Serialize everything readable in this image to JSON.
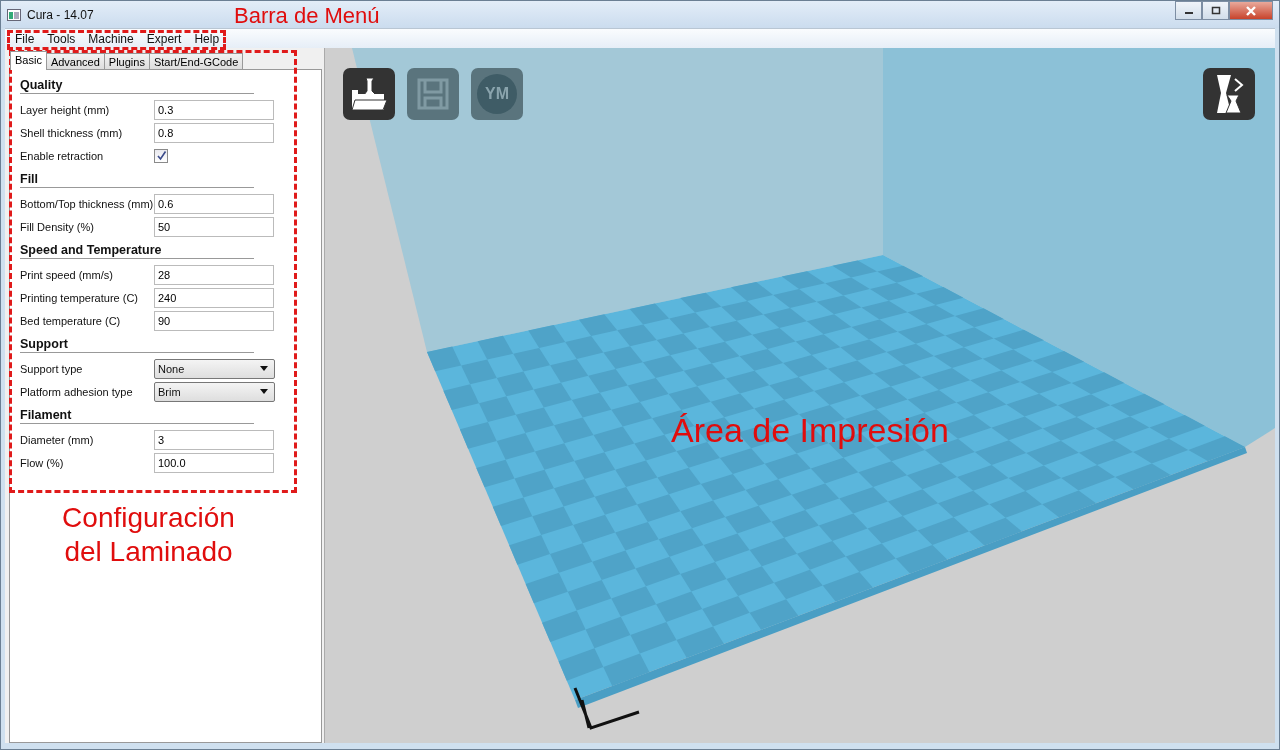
{
  "window": {
    "title": "Cura - 14.07"
  },
  "menu": [
    "File",
    "Tools",
    "Machine",
    "Expert",
    "Help"
  ],
  "tabs": [
    {
      "label": "Basic",
      "selected": true
    },
    {
      "label": "Advanced",
      "selected": false
    },
    {
      "label": "Plugins",
      "selected": false
    },
    {
      "label": "Start/End-GCode",
      "selected": false
    }
  ],
  "sections": [
    {
      "title": "Quality",
      "fields": [
        {
          "kind": "text",
          "label": "Layer height (mm)",
          "value": "0.3"
        },
        {
          "kind": "text",
          "label": "Shell thickness (mm)",
          "value": "0.8"
        },
        {
          "kind": "checkbox",
          "label": "Enable retraction",
          "checked": true
        }
      ]
    },
    {
      "title": "Fill",
      "fields": [
        {
          "kind": "text",
          "label": "Bottom/Top thickness (mm)",
          "value": "0.6"
        },
        {
          "kind": "text",
          "label": "Fill Density (%)",
          "value": "50"
        }
      ]
    },
    {
      "title": "Speed and Temperature",
      "fields": [
        {
          "kind": "text",
          "label": "Print speed (mm/s)",
          "value": "28"
        },
        {
          "kind": "text",
          "label": "Printing temperature (C)",
          "value": "240"
        },
        {
          "kind": "text",
          "label": "Bed temperature (C)",
          "value": "90"
        }
      ]
    },
    {
      "title": "Support",
      "fields": [
        {
          "kind": "select",
          "label": "Support type",
          "value": "None"
        },
        {
          "kind": "select",
          "label": "Platform adhesion type",
          "value": "Brim"
        }
      ]
    },
    {
      "title": "Filament",
      "fields": [
        {
          "kind": "text",
          "label": "Diameter (mm)",
          "value": "3"
        },
        {
          "kind": "text",
          "label": "Flow (%)",
          "value": "100.0"
        }
      ]
    }
  ],
  "toolbar": [
    {
      "kind": "load",
      "disabled": false
    },
    {
      "kind": "save",
      "disabled": true
    },
    {
      "kind": "ym",
      "label": "YM",
      "disabled": true
    }
  ],
  "view_toolbar": [
    {
      "kind": "view-mode",
      "disabled": false
    }
  ],
  "annotations": {
    "menu_bar": "Barra de Menú",
    "settings_panel": "Configuración del Laminado",
    "print_area": "Área de Impresión"
  }
}
